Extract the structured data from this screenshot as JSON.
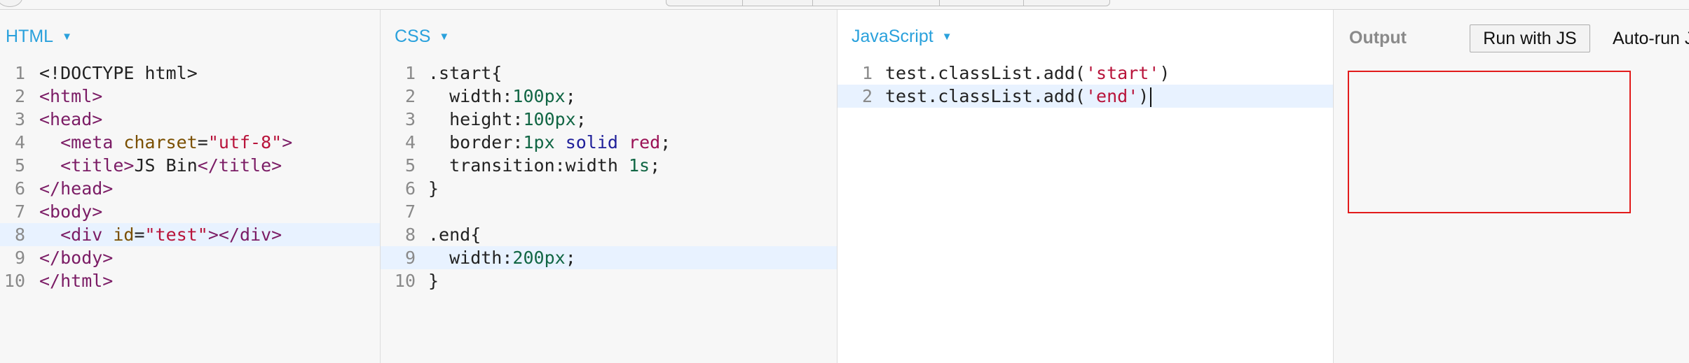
{
  "panels": {
    "html": {
      "label": "HTML"
    },
    "css": {
      "label": "CSS"
    },
    "js": {
      "label": "JavaScript"
    },
    "output": {
      "label": "Output",
      "run_button": "Run with JS",
      "autorun": "Auto-run J"
    }
  },
  "html_code": [
    {
      "n": "1",
      "tokens": [
        {
          "c": "plain",
          "t": "<!DOCTYPE html>"
        }
      ]
    },
    {
      "n": "2",
      "tokens": [
        {
          "c": "tag",
          "t": "<html>"
        }
      ]
    },
    {
      "n": "3",
      "tokens": [
        {
          "c": "tag",
          "t": "<head>"
        }
      ]
    },
    {
      "n": "4",
      "tokens": [
        {
          "c": "plain",
          "t": "  "
        },
        {
          "c": "tag",
          "t": "<meta "
        },
        {
          "c": "attr",
          "t": "charset"
        },
        {
          "c": "plain",
          "t": "="
        },
        {
          "c": "str",
          "t": "\"utf-8\""
        },
        {
          "c": "tag",
          "t": ">"
        }
      ]
    },
    {
      "n": "5",
      "tokens": [
        {
          "c": "plain",
          "t": "  "
        },
        {
          "c": "tag",
          "t": "<title>"
        },
        {
          "c": "plain",
          "t": "JS Bin"
        },
        {
          "c": "tag",
          "t": "</title>"
        }
      ]
    },
    {
      "n": "6",
      "tokens": [
        {
          "c": "tag",
          "t": "</head>"
        }
      ]
    },
    {
      "n": "7",
      "tokens": [
        {
          "c": "tag",
          "t": "<body>"
        }
      ]
    },
    {
      "n": "8",
      "active": true,
      "tokens": [
        {
          "c": "plain",
          "t": "  "
        },
        {
          "c": "tag",
          "t": "<div "
        },
        {
          "c": "attr",
          "t": "id"
        },
        {
          "c": "plain",
          "t": "="
        },
        {
          "c": "str",
          "t": "\"test\""
        },
        {
          "c": "tag",
          "t": "></div>"
        }
      ]
    },
    {
      "n": "9",
      "tokens": [
        {
          "c": "tag",
          "t": "</body>"
        }
      ]
    },
    {
      "n": "10",
      "tokens": [
        {
          "c": "tag",
          "t": "</html>"
        }
      ]
    }
  ],
  "css_code": [
    {
      "n": "1",
      "tokens": [
        {
          "c": "plain",
          "t": ".start{"
        }
      ]
    },
    {
      "n": "2",
      "tokens": [
        {
          "c": "plain",
          "t": "  width:"
        },
        {
          "c": "num",
          "t": "100px"
        },
        {
          "c": "plain",
          "t": ";"
        }
      ]
    },
    {
      "n": "3",
      "tokens": [
        {
          "c": "plain",
          "t": "  height:"
        },
        {
          "c": "num",
          "t": "100px"
        },
        {
          "c": "plain",
          "t": ";"
        }
      ]
    },
    {
      "n": "4",
      "tokens": [
        {
          "c": "plain",
          "t": "  border:"
        },
        {
          "c": "num",
          "t": "1px"
        },
        {
          "c": "plain",
          "t": " "
        },
        {
          "c": "kw",
          "t": "solid"
        },
        {
          "c": "plain",
          "t": " "
        },
        {
          "c": "val",
          "t": "red"
        },
        {
          "c": "plain",
          "t": ";"
        }
      ]
    },
    {
      "n": "5",
      "tokens": [
        {
          "c": "plain",
          "t": "  transition:width "
        },
        {
          "c": "num",
          "t": "1s"
        },
        {
          "c": "plain",
          "t": ";"
        }
      ]
    },
    {
      "n": "6",
      "tokens": [
        {
          "c": "plain",
          "t": "}"
        }
      ]
    },
    {
      "n": "7",
      "tokens": []
    },
    {
      "n": "8",
      "tokens": [
        {
          "c": "plain",
          "t": ".end{"
        }
      ]
    },
    {
      "n": "9",
      "active": true,
      "tokens": [
        {
          "c": "plain",
          "t": "  width:"
        },
        {
          "c": "num",
          "t": "200px"
        },
        {
          "c": "plain",
          "t": ";"
        }
      ]
    },
    {
      "n": "10",
      "tokens": [
        {
          "c": "plain",
          "t": "}"
        }
      ]
    }
  ],
  "js_code": [
    {
      "n": "1",
      "tokens": [
        {
          "c": "plain",
          "t": "test.classList.add("
        },
        {
          "c": "str",
          "t": "'start'"
        },
        {
          "c": "plain",
          "t": ")"
        }
      ]
    },
    {
      "n": "2",
      "active": true,
      "cursor": true,
      "tokens": [
        {
          "c": "plain",
          "t": "test.classList.add("
        },
        {
          "c": "str",
          "t": "'end'"
        },
        {
          "c": "plain",
          "t": ")"
        }
      ]
    }
  ],
  "colors": {
    "accent": "#2aa1dc",
    "box_border": "#e21b1b",
    "active_line": "#e8f2ff"
  }
}
